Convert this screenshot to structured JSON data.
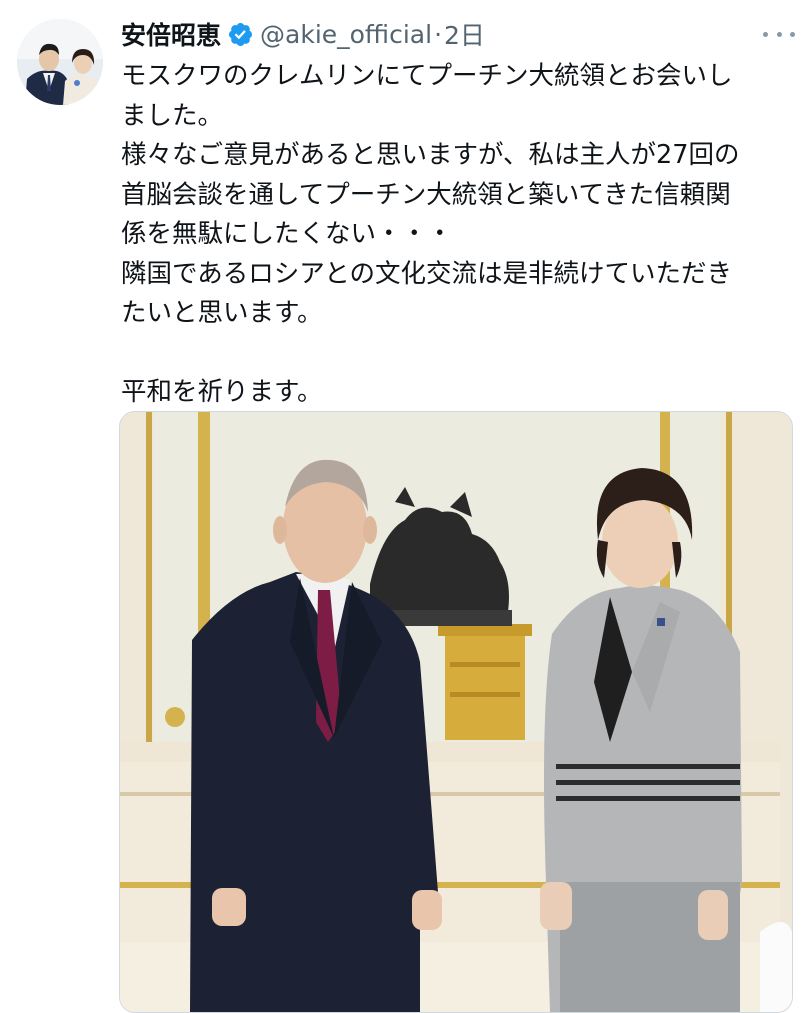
{
  "tweet": {
    "author_name": "安倍昭恵",
    "handle": "@akie_official",
    "separator": "·",
    "time": "2日",
    "lines": [
      "モスクワのクレムリンにてプーチン大統領とお会いし",
      "ました。",
      "様々なご意見があると思いますが、私は主人が27回の",
      "首脳会談を通してプーチン大統領と築いてきた信頼関",
      "係を無駄にしたくない・・・",
      "隣国であるロシアとの文化交流は是非続けていただき",
      "たいと思います。",
      "",
      "平和を祈ります。"
    ]
  },
  "colors": {
    "verified": "#1d9bf0",
    "secondary_text": "#536471"
  },
  "icons": {
    "verified": "verified-badge-icon",
    "more": "more-options-icon"
  }
}
